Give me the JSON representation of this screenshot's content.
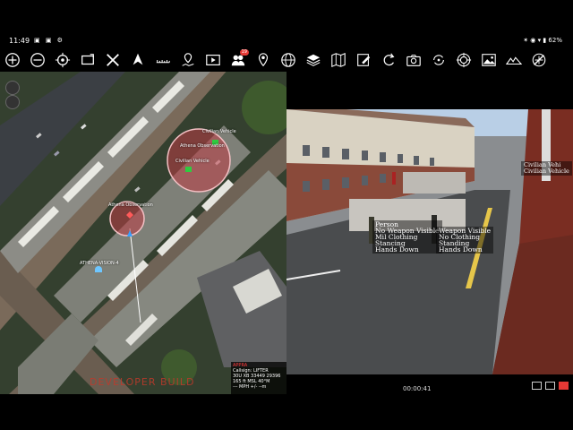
{
  "status": {
    "time": "11:49",
    "left_icons": "▣ ▣ ⚙",
    "right": "✶ ◉ ▾ ▮ 62%"
  },
  "toolbar": {
    "alert_count": "19"
  },
  "map": {
    "markers": [
      {
        "label": "Civilian Vehicle"
      },
      {
        "label": "Athena Observation"
      },
      {
        "label": "Civilian Vehicle"
      },
      {
        "label": "Athena Observation"
      },
      {
        "label": "ATHENA-VISION-4"
      }
    ],
    "info": {
      "title": "APPRA",
      "callsign": "Callsign: LIFTER",
      "grid": "30U XB  33449  29396",
      "alt": "165 ft MSL        40°M",
      "speed": "--- MPH        +/- --m"
    },
    "watermark": "DEVELOPER BUILD"
  },
  "video": {
    "detections": [
      {
        "lines": [
          "Person",
          "No Weapon Visible",
          "Mil Clothing",
          "Stancing",
          "Hands Down"
        ]
      },
      {
        "lines": [
          "Weapon Visible",
          "No Clothing",
          "Standing",
          "Hands Down"
        ]
      },
      {
        "lines": [
          "Civilian Vehi",
          "Civilian Vehicle"
        ]
      }
    ],
    "timestamp": "00:00:41"
  }
}
